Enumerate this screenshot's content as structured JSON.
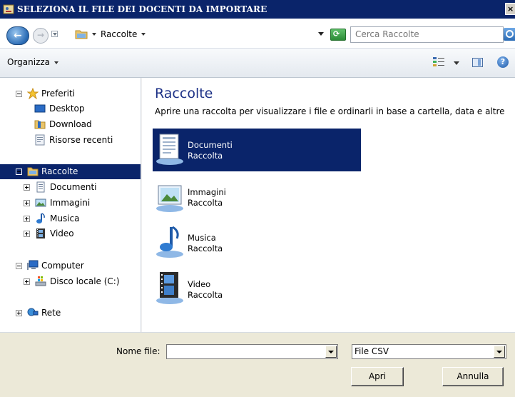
{
  "window": {
    "title": "SELEZIONA IL FILE DEI DOCENTI DA IMPORTARE",
    "close_glyph": "×"
  },
  "address": {
    "back_glyph": "←",
    "forward_glyph": "→",
    "breadcrumb": "Raccolte",
    "refresh_glyph": "⟳",
    "search_placeholder": "Cerca Raccolte"
  },
  "toolbar": {
    "organize_label": "Organizza",
    "help_glyph": "?"
  },
  "sidebar": {
    "favorites": {
      "label": "Preferiti",
      "items": [
        {
          "label": "Desktop",
          "icon": "desktop-icon"
        },
        {
          "label": "Download",
          "icon": "download-folder-icon"
        },
        {
          "label": "Risorse recenti",
          "icon": "recent-places-icon"
        }
      ]
    },
    "libraries": {
      "label": "Raccolte",
      "items": [
        {
          "label": "Documenti",
          "icon": "documents-icon"
        },
        {
          "label": "Immagini",
          "icon": "pictures-icon"
        },
        {
          "label": "Musica",
          "icon": "music-icon"
        },
        {
          "label": "Video",
          "icon": "video-icon"
        }
      ]
    },
    "computer": {
      "label": "Computer",
      "items": [
        {
          "label": "Disco locale (C:)",
          "icon": "local-disk-icon"
        }
      ]
    },
    "network": {
      "label": "Rete"
    }
  },
  "main": {
    "heading": "Raccolte",
    "description": "Aprire una raccolta per visualizzare i file e ordinarli in base a cartella, data e altre pr…",
    "libraries": [
      {
        "name": "Documenti",
        "type": "Raccolta",
        "selected": true
      },
      {
        "name": "Immagini",
        "type": "Raccolta",
        "selected": false
      },
      {
        "name": "Musica",
        "type": "Raccolta",
        "selected": false
      },
      {
        "name": "Video",
        "type": "Raccolta",
        "selected": false
      }
    ]
  },
  "footer": {
    "filename_label": "Nome file:",
    "filename_value": "",
    "filetype_value": "File CSV",
    "open_label": "Apri",
    "cancel_label": "Annulla"
  },
  "colors": {
    "title_bar": "#0a246a",
    "selection": "#0a246a",
    "heading": "#1e3287",
    "dialog_bg": "#ece9d8"
  }
}
